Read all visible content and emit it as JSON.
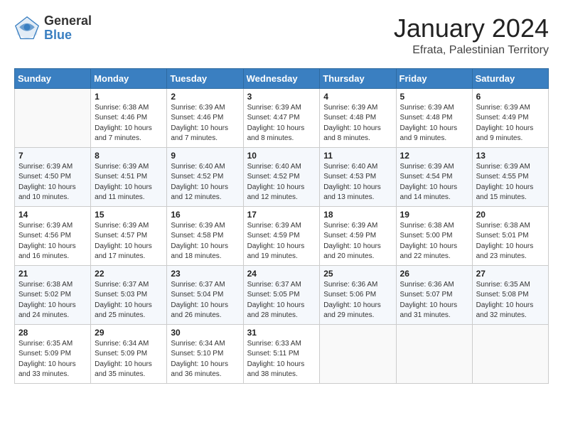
{
  "header": {
    "logo_general": "General",
    "logo_blue": "Blue",
    "month_title": "January 2024",
    "location": "Efrata, Palestinian Territory"
  },
  "calendar": {
    "days_of_week": [
      "Sunday",
      "Monday",
      "Tuesday",
      "Wednesday",
      "Thursday",
      "Friday",
      "Saturday"
    ],
    "weeks": [
      [
        {
          "day": "",
          "info": ""
        },
        {
          "day": "1",
          "info": "Sunrise: 6:38 AM\nSunset: 4:46 PM\nDaylight: 10 hours\nand 7 minutes."
        },
        {
          "day": "2",
          "info": "Sunrise: 6:39 AM\nSunset: 4:46 PM\nDaylight: 10 hours\nand 7 minutes."
        },
        {
          "day": "3",
          "info": "Sunrise: 6:39 AM\nSunset: 4:47 PM\nDaylight: 10 hours\nand 8 minutes."
        },
        {
          "day": "4",
          "info": "Sunrise: 6:39 AM\nSunset: 4:48 PM\nDaylight: 10 hours\nand 8 minutes."
        },
        {
          "day": "5",
          "info": "Sunrise: 6:39 AM\nSunset: 4:48 PM\nDaylight: 10 hours\nand 9 minutes."
        },
        {
          "day": "6",
          "info": "Sunrise: 6:39 AM\nSunset: 4:49 PM\nDaylight: 10 hours\nand 9 minutes."
        }
      ],
      [
        {
          "day": "7",
          "info": "Sunrise: 6:39 AM\nSunset: 4:50 PM\nDaylight: 10 hours\nand 10 minutes."
        },
        {
          "day": "8",
          "info": "Sunrise: 6:39 AM\nSunset: 4:51 PM\nDaylight: 10 hours\nand 11 minutes."
        },
        {
          "day": "9",
          "info": "Sunrise: 6:40 AM\nSunset: 4:52 PM\nDaylight: 10 hours\nand 12 minutes."
        },
        {
          "day": "10",
          "info": "Sunrise: 6:40 AM\nSunset: 4:52 PM\nDaylight: 10 hours\nand 12 minutes."
        },
        {
          "day": "11",
          "info": "Sunrise: 6:40 AM\nSunset: 4:53 PM\nDaylight: 10 hours\nand 13 minutes."
        },
        {
          "day": "12",
          "info": "Sunrise: 6:39 AM\nSunset: 4:54 PM\nDaylight: 10 hours\nand 14 minutes."
        },
        {
          "day": "13",
          "info": "Sunrise: 6:39 AM\nSunset: 4:55 PM\nDaylight: 10 hours\nand 15 minutes."
        }
      ],
      [
        {
          "day": "14",
          "info": "Sunrise: 6:39 AM\nSunset: 4:56 PM\nDaylight: 10 hours\nand 16 minutes."
        },
        {
          "day": "15",
          "info": "Sunrise: 6:39 AM\nSunset: 4:57 PM\nDaylight: 10 hours\nand 17 minutes."
        },
        {
          "day": "16",
          "info": "Sunrise: 6:39 AM\nSunset: 4:58 PM\nDaylight: 10 hours\nand 18 minutes."
        },
        {
          "day": "17",
          "info": "Sunrise: 6:39 AM\nSunset: 4:59 PM\nDaylight: 10 hours\nand 19 minutes."
        },
        {
          "day": "18",
          "info": "Sunrise: 6:39 AM\nSunset: 4:59 PM\nDaylight: 10 hours\nand 20 minutes."
        },
        {
          "day": "19",
          "info": "Sunrise: 6:38 AM\nSunset: 5:00 PM\nDaylight: 10 hours\nand 22 minutes."
        },
        {
          "day": "20",
          "info": "Sunrise: 6:38 AM\nSunset: 5:01 PM\nDaylight: 10 hours\nand 23 minutes."
        }
      ],
      [
        {
          "day": "21",
          "info": "Sunrise: 6:38 AM\nSunset: 5:02 PM\nDaylight: 10 hours\nand 24 minutes."
        },
        {
          "day": "22",
          "info": "Sunrise: 6:37 AM\nSunset: 5:03 PM\nDaylight: 10 hours\nand 25 minutes."
        },
        {
          "day": "23",
          "info": "Sunrise: 6:37 AM\nSunset: 5:04 PM\nDaylight: 10 hours\nand 26 minutes."
        },
        {
          "day": "24",
          "info": "Sunrise: 6:37 AM\nSunset: 5:05 PM\nDaylight: 10 hours\nand 28 minutes."
        },
        {
          "day": "25",
          "info": "Sunrise: 6:36 AM\nSunset: 5:06 PM\nDaylight: 10 hours\nand 29 minutes."
        },
        {
          "day": "26",
          "info": "Sunrise: 6:36 AM\nSunset: 5:07 PM\nDaylight: 10 hours\nand 31 minutes."
        },
        {
          "day": "27",
          "info": "Sunrise: 6:35 AM\nSunset: 5:08 PM\nDaylight: 10 hours\nand 32 minutes."
        }
      ],
      [
        {
          "day": "28",
          "info": "Sunrise: 6:35 AM\nSunset: 5:09 PM\nDaylight: 10 hours\nand 33 minutes."
        },
        {
          "day": "29",
          "info": "Sunrise: 6:34 AM\nSunset: 5:09 PM\nDaylight: 10 hours\nand 35 minutes."
        },
        {
          "day": "30",
          "info": "Sunrise: 6:34 AM\nSunset: 5:10 PM\nDaylight: 10 hours\nand 36 minutes."
        },
        {
          "day": "31",
          "info": "Sunrise: 6:33 AM\nSunset: 5:11 PM\nDaylight: 10 hours\nand 38 minutes."
        },
        {
          "day": "",
          "info": ""
        },
        {
          "day": "",
          "info": ""
        },
        {
          "day": "",
          "info": ""
        }
      ]
    ]
  }
}
